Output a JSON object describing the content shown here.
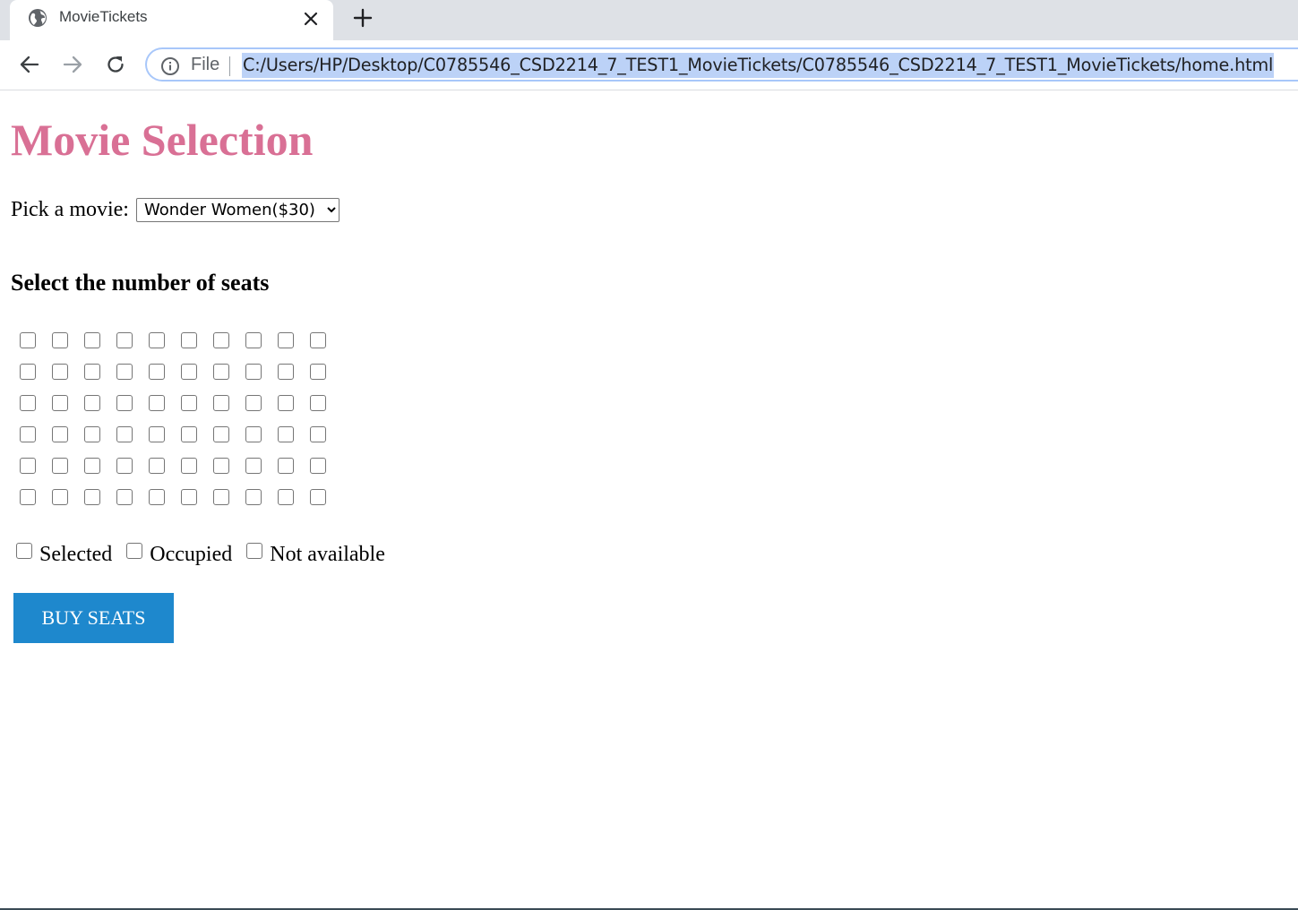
{
  "browser": {
    "tab_title": "MovieTickets",
    "scheme_label": "File",
    "url": "C:/Users/HP/Desktop/C0785546_CSD2214_7_TEST1_MovieTickets/C0785546_CSD2214_7_TEST1_MovieTickets/home.html"
  },
  "page": {
    "title": "Movie Selection",
    "title_color": "#d97095",
    "picker_label": "Pick a movie:",
    "selected_movie": "Wonder Women($30)",
    "seats_heading": "Select the number of seats",
    "seat_rows": 6,
    "seat_cols": 10,
    "legend": {
      "selected": "Selected",
      "occupied": "Occupied",
      "not_available": "Not available"
    },
    "buy_button": "BUY SEATS",
    "buy_button_color": "#1e88cd"
  }
}
